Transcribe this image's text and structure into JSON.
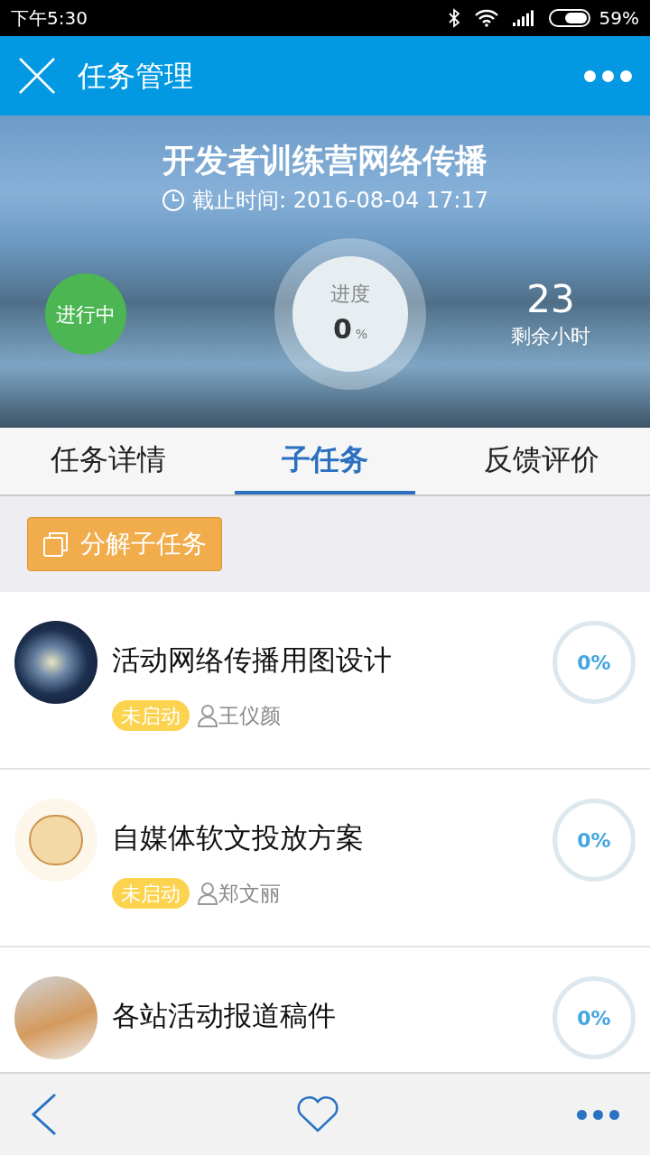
{
  "status_bar": {
    "time": "下午5:30",
    "battery": "59%"
  },
  "app_bar": {
    "title": "任务管理"
  },
  "task": {
    "title": "开发者训练营网络传播",
    "deadline": "截止时间: 2016-08-04  17:17",
    "status": "进行中",
    "progress_label": "进度",
    "progress_value": "0",
    "progress_unit": "%",
    "remaining_value": "23",
    "remaining_label": "剩余小时"
  },
  "tabs": [
    {
      "label": "任务详情",
      "selected": false
    },
    {
      "label": "子任务",
      "selected": true
    },
    {
      "label": "反馈评价",
      "selected": false
    }
  ],
  "split_button": {
    "label": "分解子任务"
  },
  "subtasks": [
    {
      "title": "活动网络传播用图设计",
      "status": "未启动",
      "assignee": "王仪颜",
      "progress": "0%",
      "kind": "galaxy"
    },
    {
      "title": "自媒体软文投放方案",
      "status": "未启动",
      "assignee": "郑文丽",
      "progress": "0%",
      "kind": "cartoon"
    },
    {
      "title": "各站活动报道稿件",
      "progress": "0%",
      "kind": "photo"
    }
  ]
}
